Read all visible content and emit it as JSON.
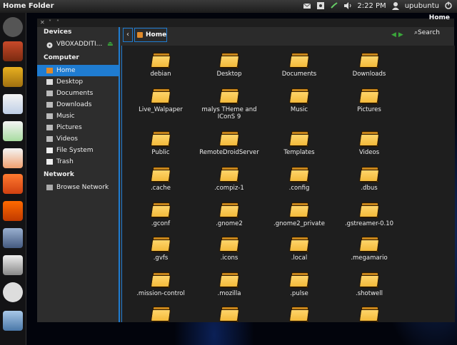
{
  "top_panel": {
    "title": "Home Folder",
    "clock": "2:22 PM",
    "user": "upubuntu"
  },
  "launcher": {
    "items": [
      "dash-icon",
      "files-icon",
      "gimp-icon",
      "writer-icon",
      "calc-icon",
      "impress-icon",
      "ubuntu-one-icon",
      "settings-icon",
      "desktop-icon",
      "disc-icon",
      "archive-icon"
    ]
  },
  "window": {
    "title": "Home",
    "sidebar": {
      "devices_heading": "Devices",
      "devices": [
        {
          "label": "VBOXADDITI..."
        }
      ],
      "computer_heading": "Computer",
      "computer": [
        {
          "label": "Home",
          "selected": true
        },
        {
          "label": "Desktop"
        },
        {
          "label": "Documents"
        },
        {
          "label": "Downloads"
        },
        {
          "label": "Music"
        },
        {
          "label": "Pictures"
        },
        {
          "label": "Videos"
        },
        {
          "label": "File System"
        },
        {
          "label": "Trash"
        }
      ],
      "network_heading": "Network",
      "network": [
        {
          "label": "Browse Network"
        }
      ]
    },
    "toolbar": {
      "back": "‹",
      "crumb": "Home",
      "search": "Search"
    },
    "files": [
      "debian",
      "Desktop",
      "Documents",
      "Downloads",
      "Live_Walpaper",
      "malys THeme and IConS 9",
      "Music",
      "Pictures",
      "Public",
      "RemoteDroidServer",
      "Templates",
      "Videos",
      ".cache",
      ".compiz-1",
      ".config",
      ".dbus",
      ".gconf",
      ".gnome2",
      ".gnome2_private",
      ".gstreamer-0.10",
      ".gvfs",
      ".icons",
      ".local",
      ".megamario",
      ".mission-control",
      ".mozilla",
      ".pulse",
      ".shotwell",
      "",
      "",
      "",
      ""
    ]
  }
}
